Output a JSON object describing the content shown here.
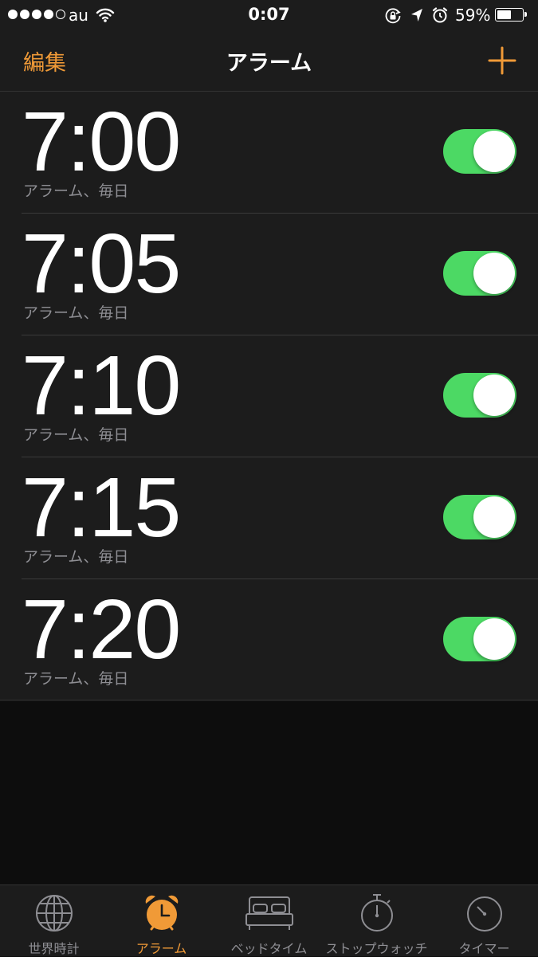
{
  "status_bar": {
    "carrier": "au",
    "time": "0:07",
    "battery_percent": "59%",
    "battery_level": 0.59,
    "signal_bars_filled": 4,
    "signal_bars_total": 5
  },
  "nav": {
    "edit_label": "編集",
    "title": "アラーム",
    "add_icon": "plus-icon"
  },
  "alarms": [
    {
      "time": "7:00",
      "label": "アラーム、毎日",
      "enabled": true
    },
    {
      "time": "7:05",
      "label": "アラーム、毎日",
      "enabled": true
    },
    {
      "time": "7:10",
      "label": "アラーム、毎日",
      "enabled": true
    },
    {
      "time": "7:15",
      "label": "アラーム、毎日",
      "enabled": true
    },
    {
      "time": "7:20",
      "label": "アラーム、毎日",
      "enabled": true
    }
  ],
  "tabs": [
    {
      "label": "世界時計",
      "icon": "globe-icon",
      "active": false
    },
    {
      "label": "アラーム",
      "icon": "alarm-clock-icon",
      "active": true
    },
    {
      "label": "ベッドタイム",
      "icon": "bed-icon",
      "active": false
    },
    {
      "label": "ストップウォッチ",
      "icon": "stopwatch-icon",
      "active": false
    },
    {
      "label": "タイマー",
      "icon": "timer-icon",
      "active": false
    }
  ],
  "colors": {
    "accent": "#f09a37",
    "toggle_on": "#4cd964",
    "background": "#1c1c1c",
    "secondary_text": "#8e8e93"
  }
}
